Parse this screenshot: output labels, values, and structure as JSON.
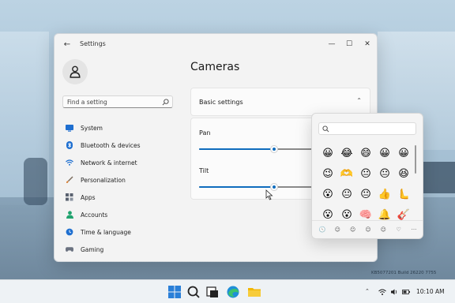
{
  "window": {
    "title": "Settings",
    "back_icon": "back-arrow-icon",
    "minimize_glyph": "—",
    "maximize_glyph": "☐",
    "close_glyph": "✕"
  },
  "sidebar": {
    "search_placeholder": "Find a setting",
    "items": [
      {
        "label": "System",
        "icon": "monitor-icon",
        "color": "#1e6fd0"
      },
      {
        "label": "Bluetooth & devices",
        "icon": "bluetooth-icon",
        "color": "#1e6fd0"
      },
      {
        "label": "Network & internet",
        "icon": "wifi-icon",
        "color": "#1e6fd0"
      },
      {
        "label": "Personalization",
        "icon": "brush-icon",
        "color": "#d87a2a"
      },
      {
        "label": "Apps",
        "icon": "apps-icon",
        "color": "#5a6270"
      },
      {
        "label": "Accounts",
        "icon": "person-icon",
        "color": "#20a36e"
      },
      {
        "label": "Time & language",
        "icon": "globe-clock-icon",
        "color": "#1e6fd0"
      },
      {
        "label": "Gaming",
        "icon": "controller-icon",
        "color": "#6b7280"
      }
    ]
  },
  "main": {
    "title": "Cameras",
    "section_label": "Basic settings",
    "chevron": "⌃",
    "sliders": [
      {
        "label": "Pan",
        "value": 0.5
      },
      {
        "label": "Tilt",
        "value": 0.5
      }
    ]
  },
  "emoji_picker": {
    "emojis": [
      "😀",
      "😂",
      "😄",
      "😀",
      "😀",
      "😉",
      "🫶",
      "😐",
      "😐",
      "😆",
      "😮",
      "😐",
      "😐",
      "👍",
      "🫷",
      "😮",
      "😮",
      "🧠",
      "🔔",
      "🎸"
    ],
    "categories": [
      "🕓",
      "☺",
      "☺",
      "☺",
      "☺",
      "♡",
      "···"
    ]
  },
  "watermark": "KB5077201 Build 26220 7755",
  "taskbar": {
    "time": "10:10 AM"
  },
  "colors": {
    "accent": "#0f6cbd"
  }
}
